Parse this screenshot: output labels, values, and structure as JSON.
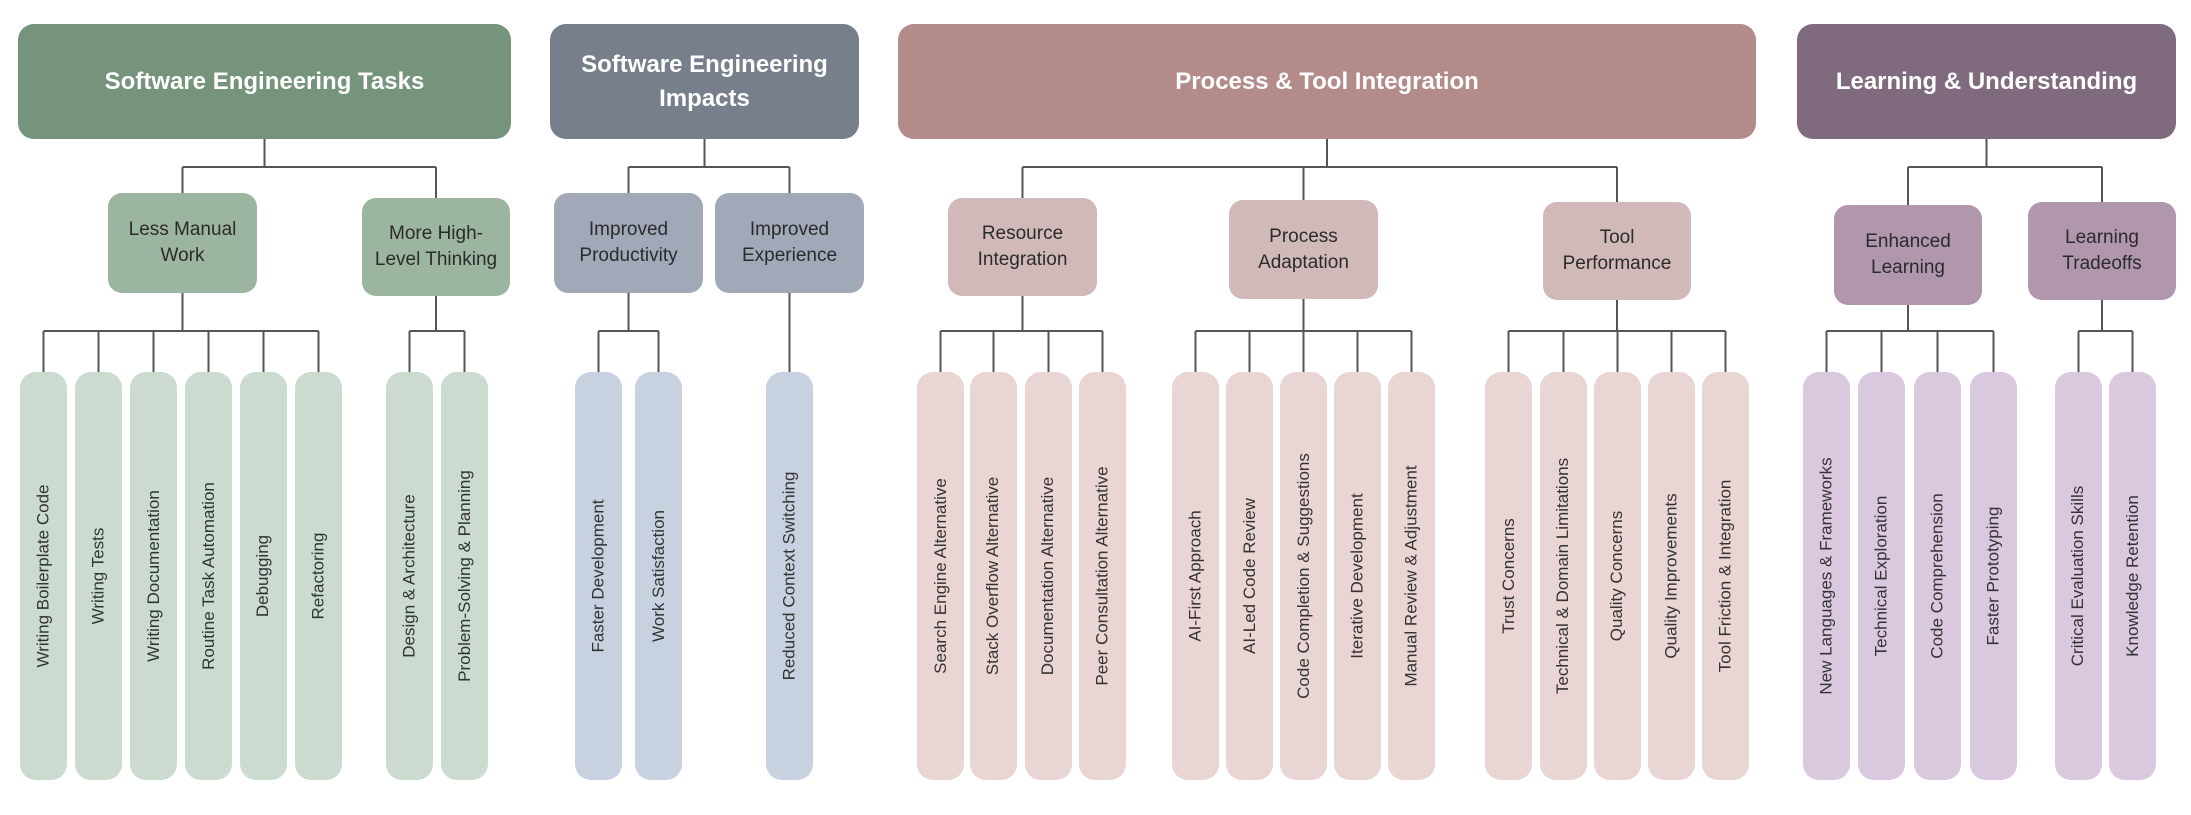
{
  "line_color": "#555555",
  "categories": [
    {
      "title": "Software Engineering Tasks",
      "colors": {
        "top": "#76937c",
        "mid": "#9cb5a1",
        "leaf": "#cbdbd0"
      },
      "children": [
        {
          "label": "Less Manual Work",
          "leaves": [
            "Writing Boilerplate Code",
            "Writing Tests",
            "Writing Documentation",
            "Routine Task Automation",
            "Debugging",
            "Refactoring"
          ]
        },
        {
          "label": "More High-Level Thinking",
          "leaves": [
            "Design & Architecture",
            "Problem-Solving & Planning"
          ]
        }
      ]
    },
    {
      "title": "Software Engineering Impacts",
      "colors": {
        "top": "#777e8c",
        "mid": "#a1a9b8",
        "leaf": "#c8d1df"
      },
      "children": [
        {
          "label": "Improved Productivity",
          "leaves": [
            "Faster Development",
            "Work Satisfaction"
          ]
        },
        {
          "label": "Improved Experience",
          "leaves": [
            "Reduced Context Switching"
          ]
        }
      ]
    },
    {
      "title": "Process & Tool Integration",
      "colors": {
        "top": "#b38b89",
        "mid": "#d1b9b9",
        "leaf": "#ead5d5"
      },
      "children": [
        {
          "label": "Resource Integration",
          "leaves": [
            "Search Engine Alternative",
            "Stack Overflow Alternative",
            "Documentation Alternative",
            "Peer Consultation Alternative"
          ]
        },
        {
          "label": "Process Adaptation",
          "leaves": [
            "AI-First Approach",
            "AI-Led Code Review",
            "Code Completion & Suggestions",
            "Iterative Development",
            "Manual Review & Adjustment"
          ]
        },
        {
          "label": "Tool Performance",
          "leaves": [
            "Trust Concerns",
            "Technical & Domain Limitations",
            "Quality Concerns",
            "Quality Improvements",
            "Tool Friction & Integration"
          ]
        }
      ]
    },
    {
      "title": "Learning & Understanding",
      "colors": {
        "top": "#7f6a7e",
        "mid": "#b097ae",
        "leaf": "#d9c8de"
      },
      "children": [
        {
          "label": "Enhanced Learning",
          "leaves": [
            "New Languages & Frameworks",
            "Technical Exploration",
            "Code Comprehension",
            "Faster Prototyping"
          ]
        },
        {
          "label": "Learning Tradeoffs",
          "leaves": [
            "Critical Evaluation Skills",
            "Knowledge Retention"
          ]
        }
      ]
    }
  ]
}
